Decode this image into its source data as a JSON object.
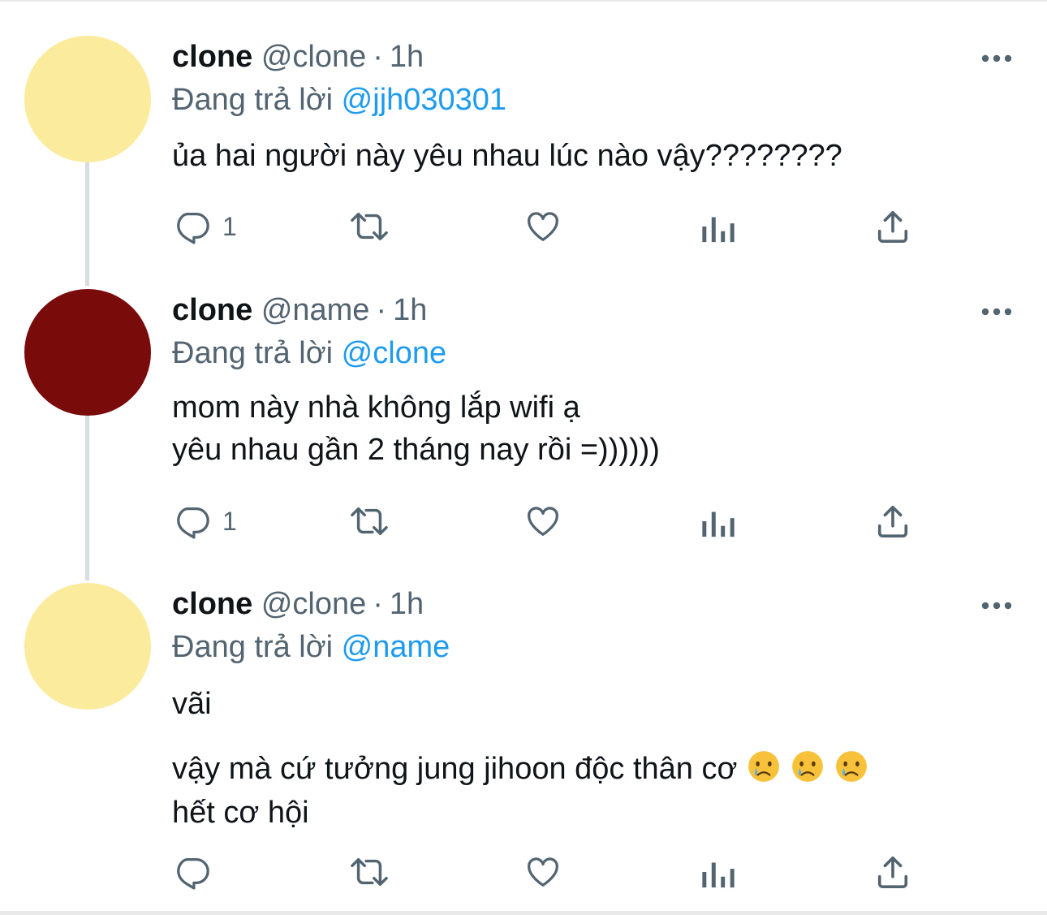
{
  "icons": {
    "reply": "reply-icon",
    "retweet": "retweet-icon",
    "like": "heart-icon",
    "analytics": "analytics-icon",
    "share": "share-icon",
    "more": "more-icon",
    "emoji": "crying-face-emoji"
  },
  "colors": {
    "accent": "#1d9bf0",
    "secondary_text": "#536471",
    "avatar_yellow": "#fbeb9c",
    "avatar_red": "#790b0b"
  },
  "tweets": [
    {
      "name": "clone",
      "handle": "@clone",
      "separator": "·",
      "time": "1h",
      "replying_prefix": "Đang trả lời",
      "replying_to": "@jjh030301",
      "lines": [
        "ủa hai người này yêu nhau lúc nào vậy????????"
      ],
      "reply_count": "1"
    },
    {
      "name": "clone",
      "handle": "@name",
      "separator": "·",
      "time": "1h",
      "replying_prefix": "Đang trả lời",
      "replying_to": "@clone",
      "lines": [
        "mom này nhà không lắp wifi ạ",
        "yêu nhau gần 2 tháng nay rồi =))))))"
      ],
      "reply_count": "1"
    },
    {
      "name": "clone",
      "handle": "@clone",
      "separator": "·",
      "time": "1h",
      "replying_prefix": "Đang trả lời",
      "replying_to": "@name",
      "lines": [
        "vãi",
        "vậy mà cứ tưởng jung jihoon độc thân cơ",
        "hết cơ hội"
      ],
      "reply_count": ""
    }
  ]
}
